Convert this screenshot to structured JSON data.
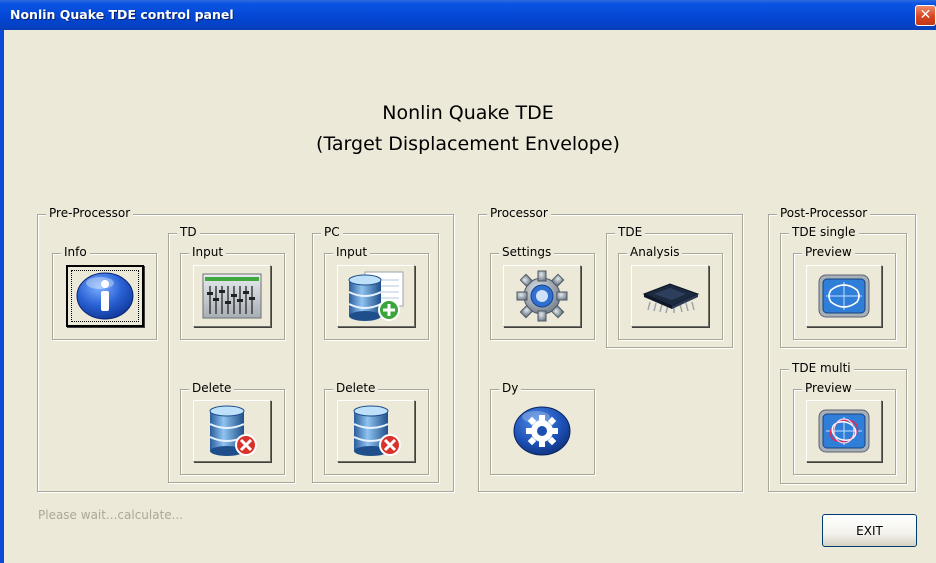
{
  "window": {
    "title": "Nonlin Quake TDE control panel",
    "close_glyph": "✕"
  },
  "header": {
    "line1": "Nonlin Quake TDE",
    "line2": "(Target Displacement Envelope)"
  },
  "pre_processor": {
    "label": "Pre-Processor",
    "info": {
      "label": "Info",
      "icon": "info-icon"
    },
    "td": {
      "label": "TD",
      "input_label": "Input",
      "input_icon": "mixer-panel-icon",
      "delete_label": "Delete",
      "delete_icon": "database-delete-icon"
    },
    "pc": {
      "label": "PC",
      "input_label": "Input",
      "input_icon": "database-add-icon",
      "delete_label": "Delete",
      "delete_icon": "database-delete-icon"
    }
  },
  "processor": {
    "label": "Processor",
    "settings": {
      "label": "Settings",
      "icon": "gear-icon"
    },
    "tde": {
      "label": "TDE",
      "analysis_label": "Analysis",
      "analysis_icon": "chip-icon"
    },
    "dy": {
      "label": "Dy",
      "icon": "gear-round-icon"
    }
  },
  "post_processor": {
    "label": "Post-Processor",
    "tde_single": {
      "label": "TDE single",
      "preview_label": "Preview",
      "icon": "envelope-chart-icon"
    },
    "tde_multi": {
      "label": "TDE multi",
      "preview_label": "Preview",
      "icon": "multi-envelope-chart-icon"
    }
  },
  "status": {
    "text": "Please wait...calculate..."
  },
  "exit_label": "EXIT",
  "colors": {
    "titlebar": "#0548d6",
    "window_bg": "#ece9d8",
    "group_border": "#a9a79a",
    "disabled_text": "#aca899"
  }
}
